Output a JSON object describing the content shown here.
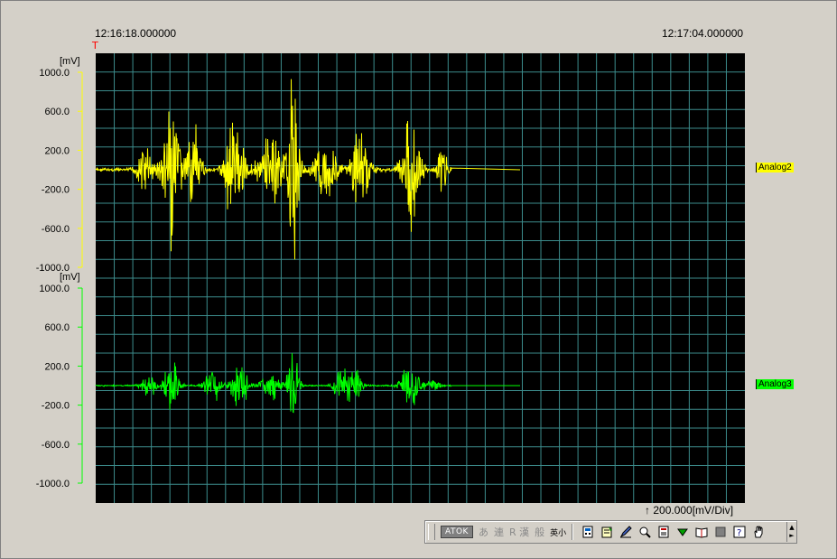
{
  "timestamps": {
    "start": "12:16:18.000000",
    "end": "12:17:04.000000"
  },
  "trigger_marker": "T",
  "scale": {
    "text": "200.000[mV/Div]",
    "arrow": "↑"
  },
  "channels": [
    {
      "name": "Analog2",
      "unit": "[mV]",
      "color": "#ffff00",
      "ticks": [
        "1000.0",
        "600.0",
        "200.0",
        "-200.0",
        "-600.0",
        "-1000.0"
      ]
    },
    {
      "name": "Analog3",
      "unit": "[mV]",
      "color": "#00ff00",
      "ticks": [
        "1000.0",
        "600.0",
        "200.0",
        "-200.0",
        "-600.0",
        "-1000.0"
      ]
    }
  ],
  "plot": {
    "background": "#000000",
    "grid_color": "#3c8c8c"
  },
  "ime_toolbar": {
    "atok_label": "ATOK",
    "items": [
      "あ",
      "連",
      "R 漢",
      "般",
      "英小"
    ],
    "icons": [
      "calculator-icon",
      "notepad-icon",
      "pen-icon",
      "search-icon",
      "dictionary-icon",
      "down-arrow-icon",
      "book-icon",
      "square-icon",
      "help-icon",
      "hand-icon"
    ],
    "help_glyph": "?"
  }
}
